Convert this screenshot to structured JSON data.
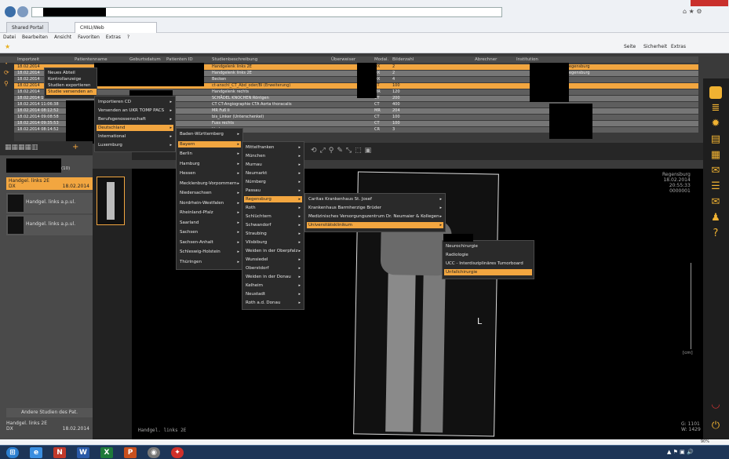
{
  "browser": {
    "tab_title": "CHILI/Web",
    "fav_link": "Shared Portal",
    "menu": [
      "Datei",
      "Bearbeiten",
      "Ansicht",
      "Favoriten",
      "Extras",
      "?"
    ],
    "cmd_bar": [
      "Seite",
      "Sicherheit",
      "Extras"
    ],
    "zoom": "90%"
  },
  "table": {
    "headers": [
      "Importzeit",
      "Patientenname",
      "Geburtsdatum",
      "Patienten ID",
      "Studienbeschreibung",
      "Überweiser",
      "Modal.",
      "Bilderzahl",
      "Abrechner",
      "Institution"
    ],
    "rows": [
      {
        "date": "18.02.2014",
        "desc": "Handgelenk links 2E",
        "mod": "DX",
        "count": "2",
        "inst": "egensburg"
      },
      {
        "date": "18.02.2014",
        "desc": "Handgelenk links 2E",
        "mod": "DX",
        "count": "2",
        "inst": "egensburg"
      },
      {
        "date": "18.02.2014",
        "desc": "Becken",
        "mod": "DX",
        "count": "4"
      },
      {
        "date": "18.02.2014",
        "desc": "ct-anschl_CT_Abd_oder/Bl (Erweiterung)",
        "mod": "CT",
        "count": "100"
      },
      {
        "date": "18.02.2014",
        "desc": "Handgelenk rechts",
        "mod": "MR",
        "count": "120"
      },
      {
        "date": "18.02.2014 11:56:18",
        "desc": "SCHÄDEL KNOCHEN Röntgen",
        "mod": "CT",
        "count": "200"
      },
      {
        "date": "18.02.2014 11:06:38",
        "desc": "CT CT-Angiographie CTA Aorta thoracalis",
        "mod": "CT",
        "count": "400"
      },
      {
        "date": "18.02.2014 08:12:52",
        "desc": "MR Fuß li",
        "mod": "MR",
        "count": "204"
      },
      {
        "date": "18.02.2014 09:08:58",
        "desc": "bis_Linker (Unterschenkel)",
        "mod": "CT",
        "count": "100"
      },
      {
        "date": "18.02.2014 09:35:53",
        "desc": "Fuss rechts",
        "mod": "CT",
        "count": "100"
      },
      {
        "date": "18.02.2014 08:14:52",
        "desc": "Hoden",
        "mod": "CR",
        "count": "3"
      }
    ]
  },
  "context_menu": {
    "items": [
      "Neues Abteil",
      "Kontrollanzeige",
      "Studien exportieren",
      "Studie versenden an"
    ],
    "selected": "Studie versenden an"
  },
  "submenu1": {
    "items": [
      "Importieren CD",
      "Versenden an UKR TOMP PACS",
      "Berufsgenossenschaft",
      "Deutschland",
      "International",
      "Luxemburg"
    ],
    "selected": "Deutschland"
  },
  "submenu2": {
    "items": [
      "Baden-Württemberg",
      "Bayern",
      "Berlin",
      "Hamburg",
      "Hessen",
      "Mecklenburg-Vorpommern",
      "Niedersachsen",
      "Nordrhein-Westfalen",
      "Rheinland-Pfalz",
      "Saarland",
      "Sachsen",
      "Sachsen-Anhalt",
      "Schleswig-Holstein",
      "Thüringen"
    ],
    "selected": "Bayern"
  },
  "submenu3": {
    "items": [
      "Mittelfranken",
      "München",
      "Murnau",
      "Neumarkt",
      "Nürnberg",
      "Passau",
      "Regensburg",
      "Roth",
      "Schlüchtern",
      "Schwandorf",
      "Straubing",
      "Vilsbiburg",
      "Weiden in der Oberpfalz",
      "Wunsiedel",
      "Oberstdorf",
      "Weiden in der Donau",
      "Kelheim",
      "Neustadt",
      "Roth a.d. Donau"
    ],
    "selected": "Regensburg"
  },
  "submenu4": {
    "items": [
      "Caritas Krankenhaus St. Josef",
      "Krankenhaus Barmherzige Brüder",
      "Medizinisches Versorgungszentrum Dr. Neumaier & Kollegen",
      "Universitätsklinikum"
    ],
    "selected": "Universitätsklinikum"
  },
  "submenu5": {
    "items": [
      "Neurochirurgie",
      "Radiologie",
      "UCC - Interdisziplinäres Tumorboard",
      "Unfallchirurgie"
    ],
    "selected": "Unfallchirurgie"
  },
  "left": {
    "count": "(10)",
    "study_title": "Handgel. links 2E",
    "study_mod": "DX",
    "study_date": "18.02.2014",
    "series": [
      {
        "label": "Handgel. links a.p.ul."
      },
      {
        "label": "Handgel. links a.p.ul."
      }
    ],
    "other_studies": "Andere Studien des Pat.",
    "footer_title": "Handgel. links 2E",
    "footer_mod": "DX",
    "footer_date": "18.02.2014"
  },
  "viewer": {
    "overlay_tr": [
      "Regensburg",
      "18.02.2014",
      "20:55:33",
      "0000001"
    ],
    "overlay_bl": "Handgel. links 2E",
    "overlay_br": [
      "G: 1101",
      "W: 1429"
    ],
    "scale_label": "[cm]",
    "marker": "L"
  }
}
